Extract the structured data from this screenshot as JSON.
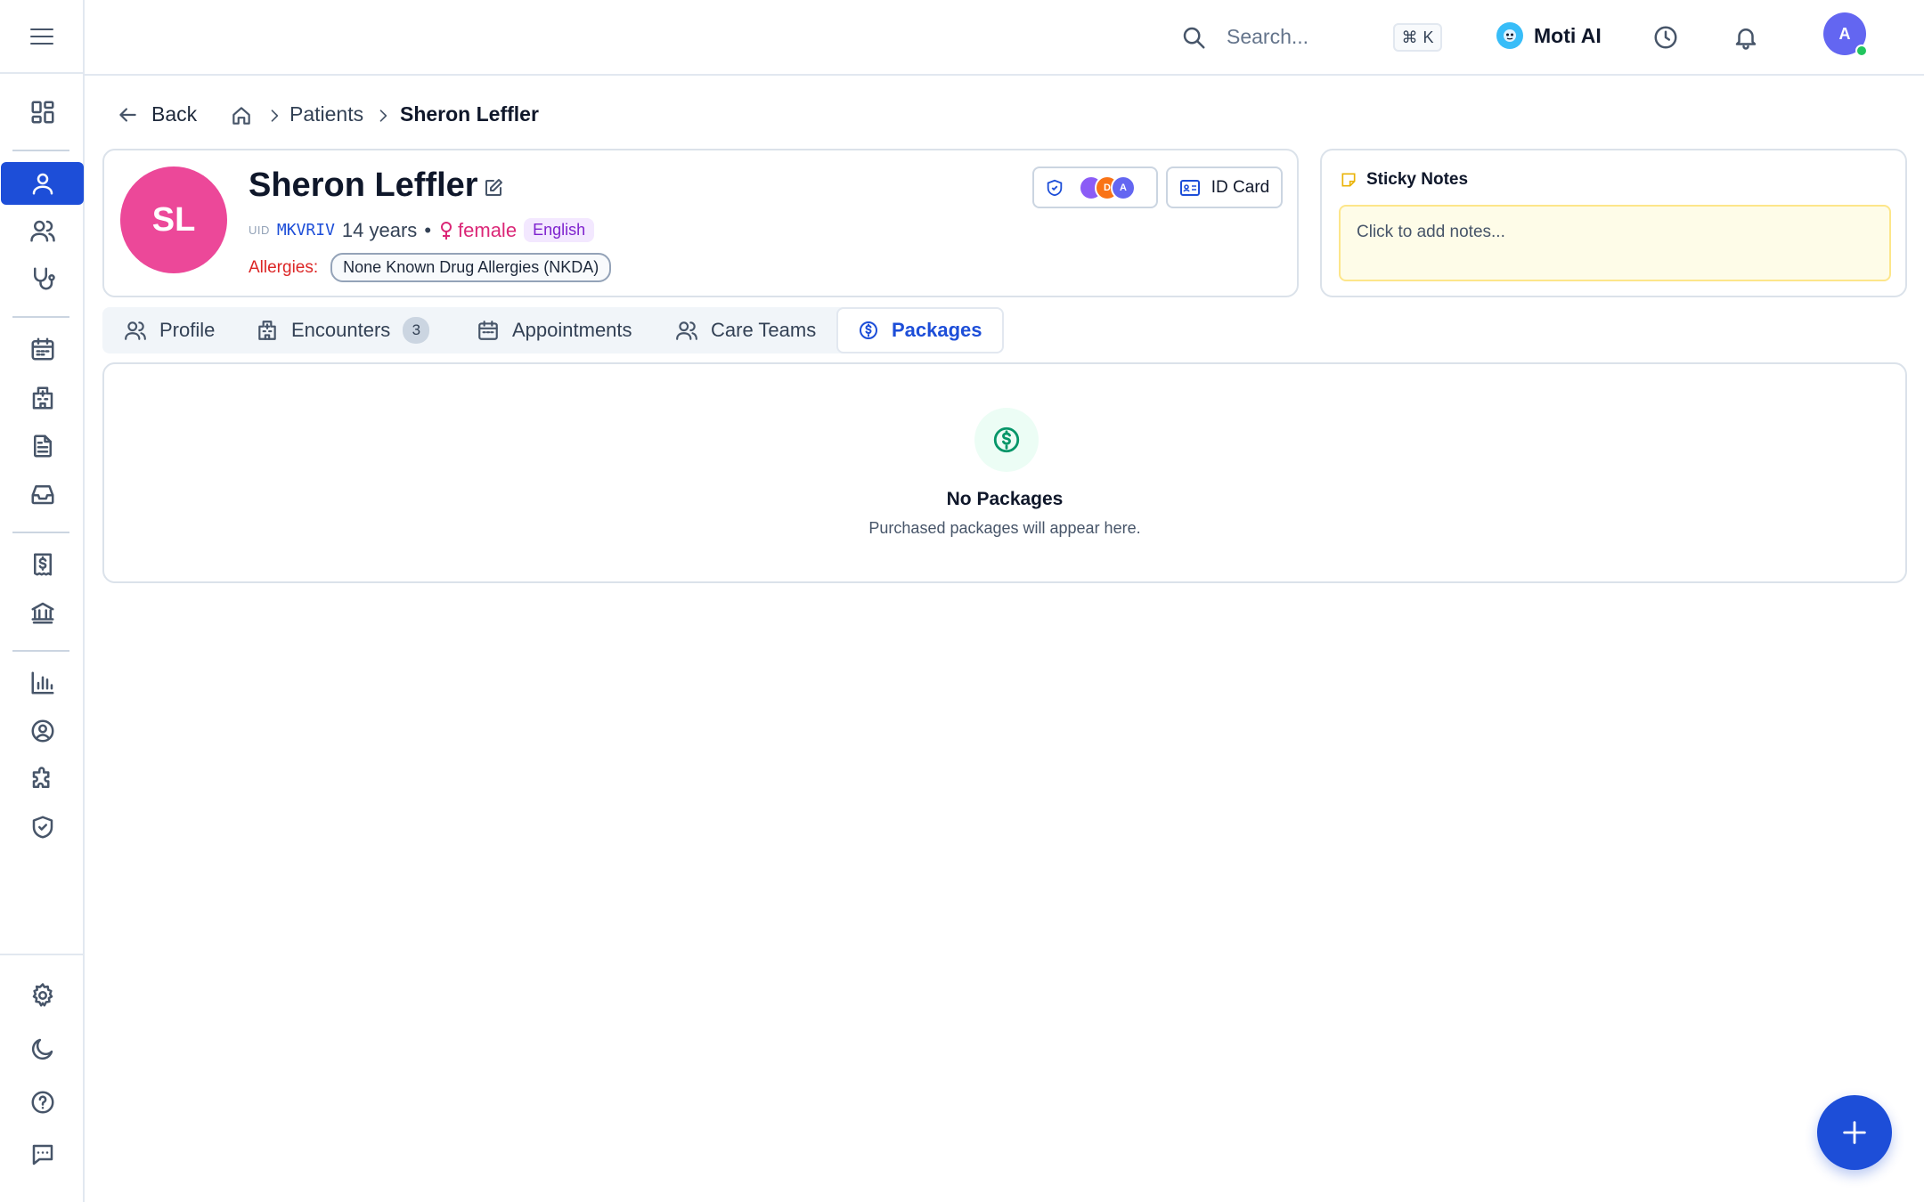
{
  "header": {
    "search_placeholder": "Search...",
    "shortcut_symbol": "⌘",
    "shortcut_key": "K",
    "assistant_label": "Moti AI",
    "user_avatar_initial": "A"
  },
  "sidebar": {
    "items": [
      {
        "icon": "dashboard-icon"
      },
      {
        "icon": "user-icon",
        "active": true
      },
      {
        "icon": "users-icon"
      },
      {
        "icon": "stethoscope-icon"
      },
      {
        "icon": "calendar-icon"
      },
      {
        "icon": "hospital-icon"
      },
      {
        "icon": "document-icon"
      },
      {
        "icon": "inbox-icon"
      },
      {
        "icon": "billing-icon"
      },
      {
        "icon": "bank-icon"
      },
      {
        "icon": "chart-icon"
      },
      {
        "icon": "user-circle-icon"
      },
      {
        "icon": "puzzle-icon"
      },
      {
        "icon": "shield-icon"
      },
      {
        "icon": "gear-icon"
      },
      {
        "icon": "moon-icon"
      },
      {
        "icon": "help-icon"
      },
      {
        "icon": "chat-icon"
      }
    ]
  },
  "breadcrumb": {
    "back_label": "Back",
    "patients_label": "Patients",
    "current_label": "Sheron Leffler"
  },
  "patient": {
    "initials": "SL",
    "name": "Sheron Leffler",
    "uid_label": "UID",
    "uid": "MKVRIV",
    "age": "14 years",
    "separator": "•",
    "gender": "female",
    "language": "English",
    "allergies_label": "Allergies:",
    "allergy": "None Known Drug Allergies (NKDA)",
    "care_team_avatars": [
      "",
      "D",
      "A"
    ],
    "id_card_label": "ID Card"
  },
  "sticky_notes": {
    "title": "Sticky Notes",
    "placeholder": "Click to add notes..."
  },
  "tabs": [
    {
      "label": "Profile",
      "icon": "users-icon"
    },
    {
      "label": "Encounters",
      "icon": "hospital-icon",
      "badge": "3"
    },
    {
      "label": "Appointments",
      "icon": "calendar-icon"
    },
    {
      "label": "Care Teams",
      "icon": "users-icon"
    },
    {
      "label": "Packages",
      "icon": "dollar-circle-icon",
      "active": true
    }
  ],
  "packages": {
    "empty_title": "No Packages",
    "empty_subtitle": "Purchased packages will appear here."
  },
  "colors": {
    "primary": "#1d4ed8",
    "avatar_pink": "#ec4899",
    "allergy_red": "#dc2626",
    "language_purple": "#7e22ce",
    "success_green": "#059669"
  }
}
